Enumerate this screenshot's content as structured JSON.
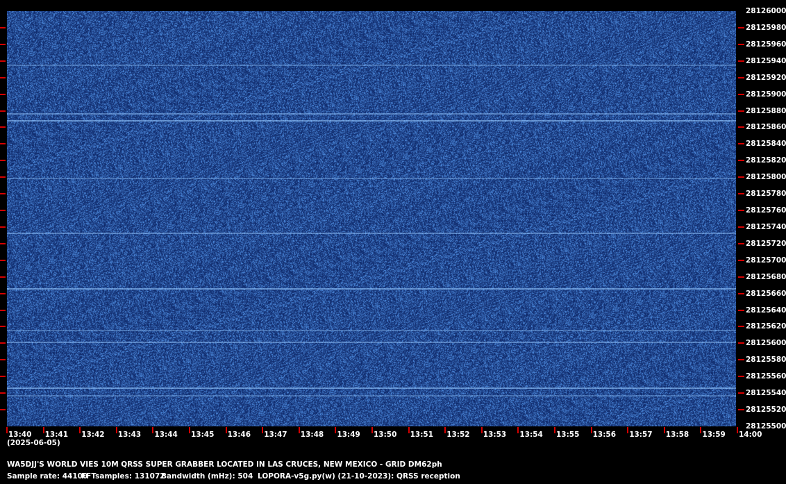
{
  "colors": {
    "background": "#000000",
    "waterfall": "#1c3f85",
    "tick_marks": "#d40000",
    "text": "#ffffff"
  },
  "frequency_axis": {
    "labels": [
      "28126000",
      "28125980",
      "28125960",
      "28125940",
      "28125920",
      "28125900",
      "28125880",
      "28125860",
      "28125840",
      "28125820",
      "28125800",
      "28125780",
      "28125760",
      "28125740",
      "28125720",
      "28125700",
      "28125680",
      "28125660",
      "28125640",
      "28125620",
      "28125600",
      "28125580",
      "28125560",
      "28125540",
      "28125520",
      "28125500"
    ]
  },
  "time_axis": {
    "labels": [
      "13:40",
      "13:41",
      "13:42",
      "13:43",
      "13:44",
      "13:45",
      "13:46",
      "13:47",
      "13:48",
      "13:49",
      "13:50",
      "13:51",
      "13:52",
      "13:53",
      "13:54",
      "13:55",
      "13:56",
      "13:57",
      "13:58",
      "13:59",
      "14:00"
    ],
    "date": "(2025-06-05)"
  },
  "signal_frequencies": [
    28125936,
    28125877,
    28125869,
    28125799,
    28125733,
    28125666,
    28125616,
    28125602,
    28125547,
    28125538
  ],
  "footer": {
    "title": "WA5DJJ'S WORLD VIES 10M QRSS SUPER GRABBER LOCATED IN LAS CRUCES, NEW MEXICO - GRID DM62ph",
    "sample_rate": "Sample rate: 44100",
    "fft_samples": "FFTsamples: 131072",
    "bandwidth": "Bandwidth (mHz): 504",
    "software": "LOPORA-v5g.py(w) (21-10-2023): QRSS reception"
  }
}
